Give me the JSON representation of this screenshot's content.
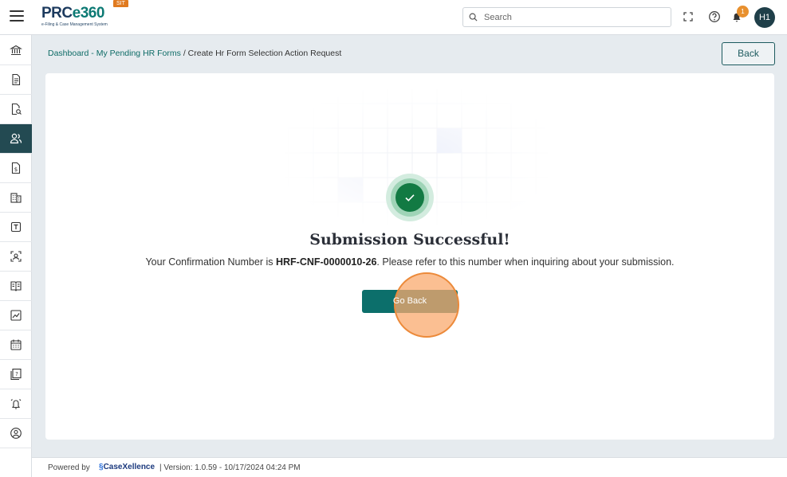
{
  "header": {
    "logo_text_a": "PRC",
    "logo_text_b": "e360",
    "logo_subtitle": "e-Filing & Case Management System",
    "env_badge": "SIT",
    "search_placeholder": "Search",
    "notification_count": "1",
    "avatar_initials": "H1"
  },
  "sidebar": {
    "items": [
      {
        "icon": "bank-icon"
      },
      {
        "icon": "document-icon"
      },
      {
        "icon": "document-search-icon"
      },
      {
        "icon": "users-icon",
        "active": true
      },
      {
        "icon": "dollar-document-icon"
      },
      {
        "icon": "building-icon"
      },
      {
        "icon": "text-box-icon"
      },
      {
        "icon": "scan-icon"
      },
      {
        "icon": "book-icon"
      },
      {
        "icon": "chart-icon"
      },
      {
        "icon": "calendar-icon"
      },
      {
        "icon": "help-document-icon"
      },
      {
        "icon": "alarm-icon"
      },
      {
        "icon": "user-circle-icon"
      }
    ]
  },
  "breadcrumb": {
    "link": "Dashboard - My Pending HR Forms",
    "separator": " / ",
    "current": "Create Hr Form Selection Action Request"
  },
  "back_button": "Back",
  "result": {
    "title": "Submission Successful!",
    "message_prefix": "Your Confirmation Number is ",
    "confirmation_number": "HRF-CNF-0000010-26",
    "message_suffix": ". Please refer to this number when inquiring about your submission.",
    "go_back_label": "Go Back"
  },
  "footer": {
    "powered_by": "Powered by",
    "brand_a": "Case",
    "brand_b": "Xellence",
    "version": "|   Version: 1.0.59 - 10/17/2024 04:24 PM"
  },
  "colors": {
    "primary": "#0c6f6b",
    "sidebar_active": "#234a52",
    "success": "#127a43",
    "badge": "#e8902e"
  }
}
